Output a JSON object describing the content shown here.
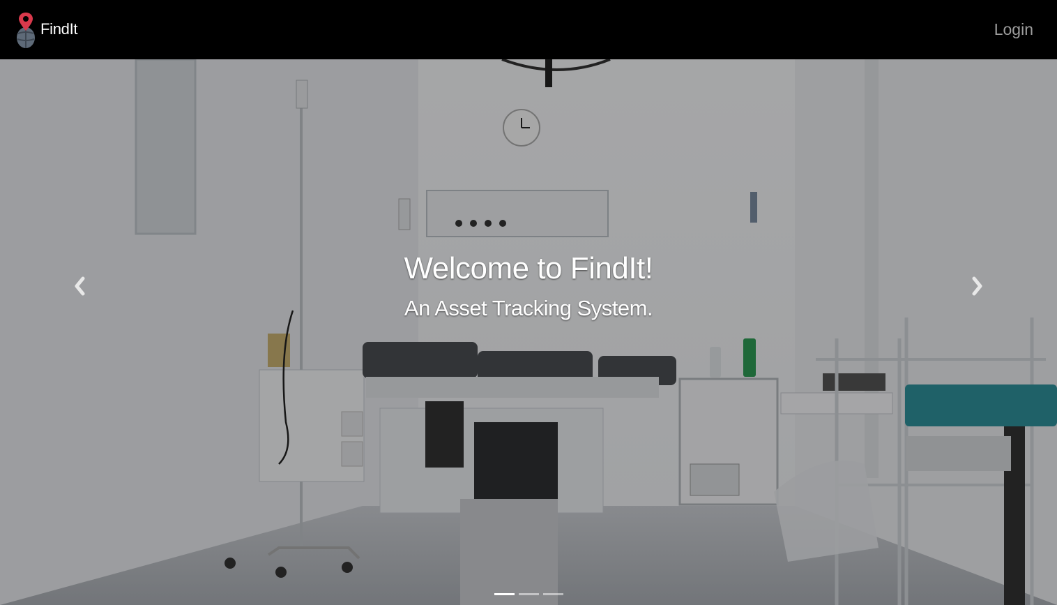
{
  "navbar": {
    "brand_name": "FindIt",
    "login_label": "Login"
  },
  "hero": {
    "title": "Welcome to FindIt!",
    "subtitle": "An Asset Tracking System.",
    "active_slide": 0,
    "slide_count": 3
  },
  "icons": {
    "brand": "map-pin-globe-icon",
    "prev": "chevron-left-icon",
    "next": "chevron-right-icon"
  },
  "colors": {
    "navbar_bg": "#000000",
    "login_text": "#9d9d9d",
    "pin_red": "#d9394c",
    "teal_stool": "#2f8f9a"
  }
}
